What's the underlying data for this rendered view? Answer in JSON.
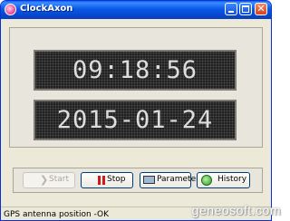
{
  "window": {
    "title": "ClockAxon"
  },
  "display": {
    "time": "09:18:56",
    "date": "2015-01-24"
  },
  "buttons": {
    "start": "Start",
    "stop": "Stop",
    "parameters": "Parameters",
    "history": "History"
  },
  "status": {
    "text": "GPS antenna position -OK"
  },
  "watermark": "geneosoft.com",
  "icons": {
    "app": "clock-app-icon",
    "start": "arrow-right-icon",
    "stop": "pause-icon",
    "parameters": "monitor-icon",
    "history": "history-icon"
  },
  "colors": {
    "titlebar": "#0a58e8",
    "led_bg": "#202020",
    "led_text": "#ececec",
    "stop_icon": "#d01818"
  }
}
